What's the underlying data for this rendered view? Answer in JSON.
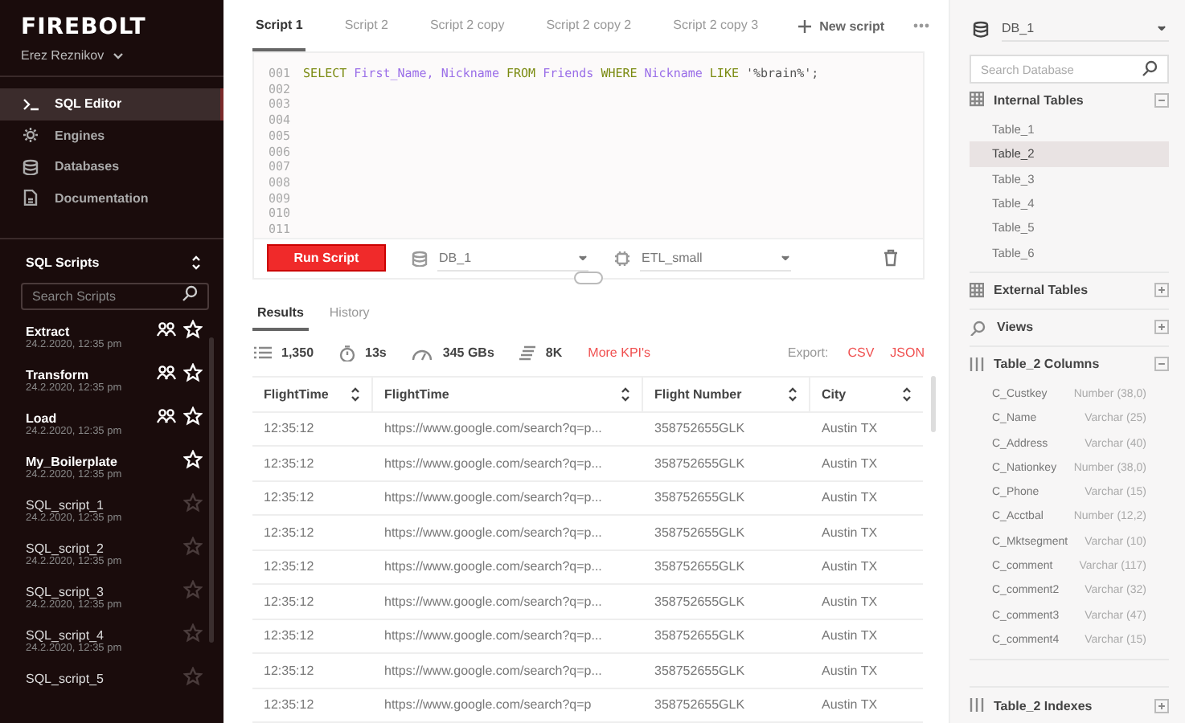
{
  "sidebar": {
    "logo": "FIREBOLT",
    "user": "Erez Reznikov",
    "nav": [
      {
        "label": "SQL Editor",
        "selected": true
      },
      {
        "label": "Engines",
        "selected": false
      },
      {
        "label": "Databases",
        "selected": false
      },
      {
        "label": "Documentation",
        "selected": false
      }
    ],
    "scripts_title": "SQL Scripts",
    "search_placeholder": "Search Scripts",
    "favorites": [
      {
        "name": "Extract",
        "date": "24.2.2020, 12:35 pm",
        "shared": true,
        "starred": true
      },
      {
        "name": "Transform",
        "date": "24.2.2020, 12:35 pm",
        "shared": true,
        "starred": true
      },
      {
        "name": "Load",
        "date": "24.2.2020, 12:35 pm",
        "shared": true,
        "starred": true
      },
      {
        "name": "My_Boilerplate",
        "date": "24.2.2020, 12:35 pm",
        "shared": false,
        "starred": true
      }
    ],
    "scripts": [
      {
        "name": "SQL_script_1",
        "date": "24.2.2020, 12:35 pm",
        "shared": false,
        "starred": false
      },
      {
        "name": "SQL_script_2",
        "date": "24.2.2020, 12:35 pm",
        "shared": false,
        "starred": false
      },
      {
        "name": "SQL_script_3",
        "date": "24.2.2020, 12:35 pm",
        "shared": false,
        "starred": false
      },
      {
        "name": "SQL_script_4",
        "date": "24.2.2020, 12:35 pm",
        "shared": false,
        "starred": false
      },
      {
        "name": "SQL_script_5",
        "shared": false,
        "starred": false
      }
    ]
  },
  "tabs": [
    {
      "label": "Script 1",
      "selected": true
    },
    {
      "label": "Script 2",
      "selected": false
    },
    {
      "label": "Script 2 copy",
      "selected": false
    },
    {
      "label": "Script 2 copy 2",
      "selected": false
    },
    {
      "label": "Script 2 copy 3",
      "selected": false
    }
  ],
  "new_script": "New script",
  "editor": {
    "line_numbers": [
      "001",
      "002",
      "003",
      "004",
      "005",
      "006",
      "007",
      "008",
      "009",
      "010",
      "011"
    ],
    "code": [
      {
        "text": "SELECT",
        "kind": "keyword"
      },
      {
        "text": "First_Name,",
        "kind": "identifier"
      },
      {
        "text": "Nickname",
        "kind": "identifier"
      },
      {
        "text": "FROM",
        "kind": "keyword"
      },
      {
        "text": "Friends",
        "kind": "identifier"
      },
      {
        "text": "WHERE",
        "kind": "keyword"
      },
      {
        "text": "Nickname",
        "kind": "identifier"
      },
      {
        "text": "LIKE",
        "kind": "keyword"
      },
      {
        "text": "'%brain%';",
        "kind": "string"
      }
    ],
    "run_button": "Run Script",
    "database": "DB_1",
    "engine": "ETL_small"
  },
  "results_tabs": [
    {
      "label": "Results",
      "selected": true
    },
    {
      "label": "History",
      "selected": false
    }
  ],
  "kpis": [
    "1,350",
    "13s",
    "345 GBs",
    "8K"
  ],
  "more_kpis": "More KPI's",
  "export_label": "Export:",
  "export_links": [
    "CSV",
    "JSON"
  ],
  "table": {
    "columns": [
      "FlightTime",
      "FlightTime",
      "Flight Number",
      "City"
    ],
    "rows": [
      [
        "12:35:12",
        "https://www.google.com/search?q=p...",
        "358752655GLK",
        "Austin TX"
      ],
      [
        "12:35:12",
        "https://www.google.com/search?q=p...",
        "358752655GLK",
        "Austin TX"
      ],
      [
        "12:35:12",
        "https://www.google.com/search?q=p...",
        "358752655GLK",
        "Austin TX"
      ],
      [
        "12:35:12",
        "https://www.google.com/search?q=p...",
        "358752655GLK",
        "Austin TX"
      ],
      [
        "12:35:12",
        "https://www.google.com/search?q=p...",
        "358752655GLK",
        "Austin TX"
      ],
      [
        "12:35:12",
        "https://www.google.com/search?q=p...",
        "358752655GLK",
        "Austin TX"
      ],
      [
        "12:35:12",
        "https://www.google.com/search?q=p...",
        "358752655GLK",
        "Austin TX"
      ],
      [
        "12:35:12",
        "https://www.google.com/search?q=p...",
        "358752655GLK",
        "Austin TX"
      ],
      [
        "12:35:12",
        "https://www.google.com/search?q=p",
        "358752655GLK",
        "Austin TX"
      ]
    ]
  },
  "db_panel": {
    "database": "DB_1",
    "search_placeholder": "Search Database",
    "sections": [
      {
        "kind": "tables",
        "title": "Internal Tables",
        "expanded": true,
        "items": [
          {
            "name": "Table_1",
            "selected": false
          },
          {
            "name": "Table_2",
            "selected": true
          },
          {
            "name": "Table_3",
            "selected": false
          },
          {
            "name": "Table_4",
            "selected": false
          },
          {
            "name": "Table_5",
            "selected": false
          },
          {
            "name": "Table_6",
            "selected": false
          }
        ]
      },
      {
        "kind": "tables",
        "title": "External Tables",
        "expanded": false
      },
      {
        "kind": "views",
        "title": "Views",
        "expanded": false
      },
      {
        "kind": "columns",
        "title": "Table_2 Columns",
        "expanded": true,
        "columns": [
          {
            "name": "C_Custkey",
            "type": "Number (38,0)"
          },
          {
            "name": "C_Name",
            "type": "Varchar (25)"
          },
          {
            "name": "C_Address",
            "type": "Varchar (40)"
          },
          {
            "name": "C_Nationkey",
            "type": "Number (38,0)"
          },
          {
            "name": "C_Phone",
            "type": "Varchar (15)"
          },
          {
            "name": "C_Acctbal",
            "type": "Number (12,2)"
          },
          {
            "name": "C_Mktsegment",
            "type": "Varchar (10)"
          },
          {
            "name": "C_comment",
            "type": "Varchar (117)"
          },
          {
            "name": "C_comment2",
            "type": "Varchar (32)"
          },
          {
            "name": "C_comment3",
            "type": "Varchar (47)"
          },
          {
            "name": "C_comment4",
            "type": "Varchar (15)"
          }
        ]
      },
      {
        "kind": "columns",
        "title": "Table_2 Indexes",
        "expanded": false
      }
    ]
  }
}
